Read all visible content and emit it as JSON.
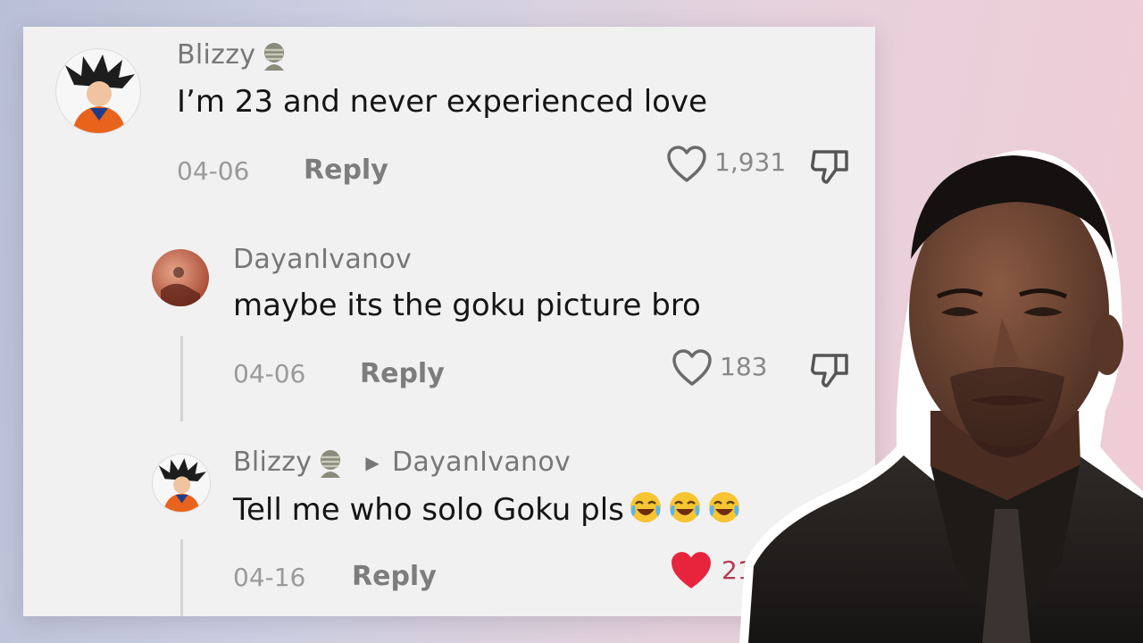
{
  "comments": [
    {
      "username": "Blizzy",
      "text": "I’m 23 and never experienced love",
      "date": "04-06",
      "reply_label": "Reply",
      "likes": "1,931",
      "liked": false,
      "avatar_icon": "goku-avatar"
    },
    {
      "username": "DayanIvanov",
      "text": "maybe its the goku picture bro",
      "date": "04-06",
      "reply_label": "Reply",
      "likes": "183",
      "liked": false,
      "avatar_icon": "reddish-photo-avatar"
    },
    {
      "username": "Blizzy",
      "reply_to": "DayanIvanov",
      "text": "Tell me who solo Goku pls",
      "emoji": [
        "joy-emoji",
        "joy-emoji",
        "joy-emoji"
      ],
      "date": "04-16",
      "reply_label": "Reply",
      "likes": "21",
      "liked": true,
      "avatar_icon": "goku-avatar"
    }
  ],
  "colors": {
    "liked_heart": "#e8243c",
    "username": "#777777",
    "body_text": "#151515"
  }
}
